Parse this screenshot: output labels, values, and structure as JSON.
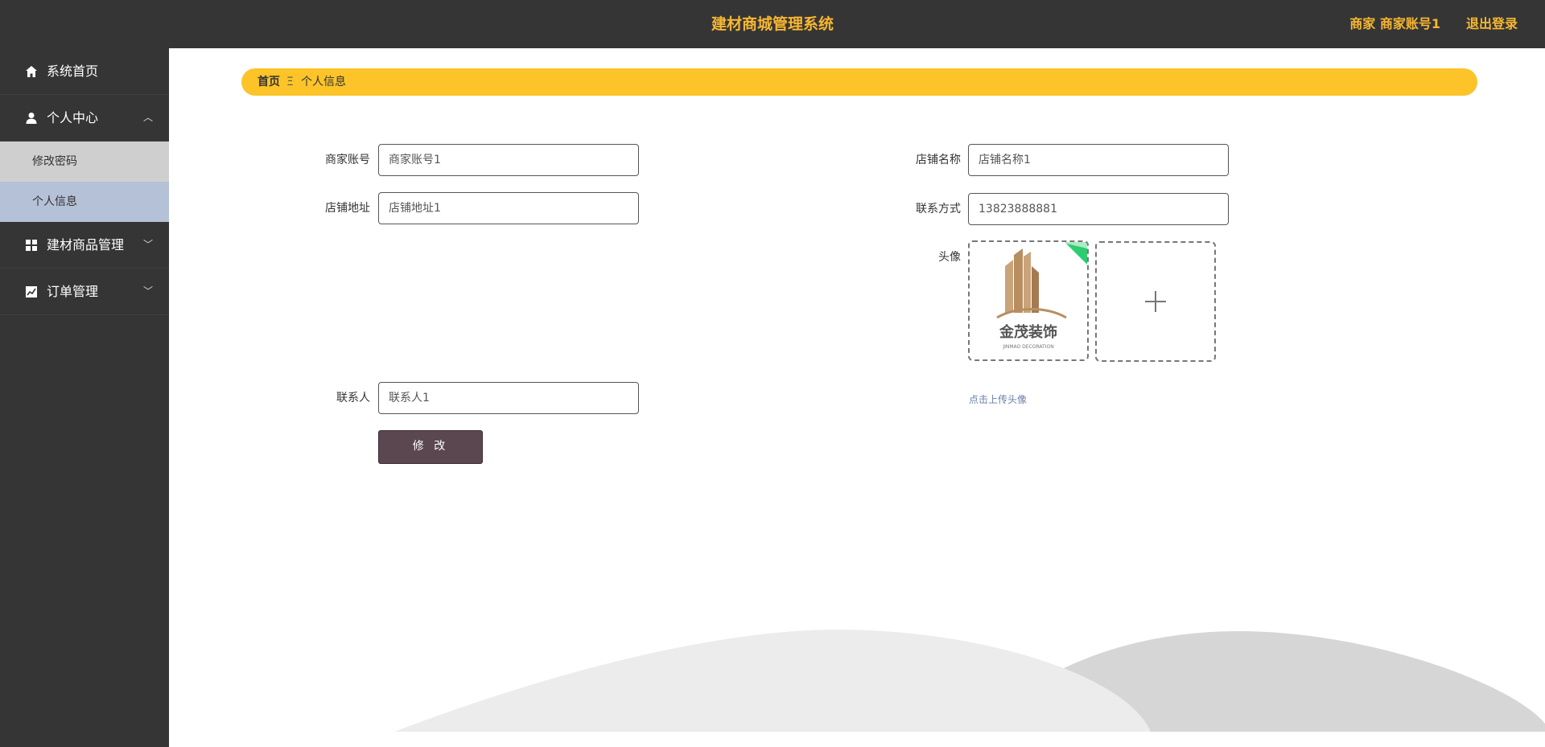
{
  "header": {
    "title": "建材商城管理系统",
    "user": "商家 商家账号1",
    "logout": "退出登录"
  },
  "sidebar": {
    "items": [
      {
        "label": "系统首页",
        "icon": "home-icon"
      },
      {
        "label": "个人中心",
        "icon": "user-icon"
      },
      {
        "label": "建材商品管理",
        "icon": "grid-icon"
      },
      {
        "label": "订单管理",
        "icon": "chart-icon"
      }
    ],
    "submenu": [
      "修改密码",
      "个人信息"
    ]
  },
  "breadcrumb": {
    "home": "首页",
    "separator": "Ξ",
    "current": "个人信息"
  },
  "form": {
    "account_label": "商家账号",
    "account_value": "商家账号1",
    "shop_name_label": "店铺名称",
    "shop_name_value": "店铺名称1",
    "address_label": "店铺地址",
    "address_value": "店铺地址1",
    "phone_label": "联系方式",
    "phone_value": "13823888881",
    "avatar_label": "头像",
    "contact_label": "联系人",
    "contact_value": "联系人1",
    "submit_label": "修 改",
    "upload_hint": "点击上传头像",
    "logo_text": "金茂装饰",
    "logo_subtext": "JINMAO DECORATION"
  },
  "colors": {
    "accent": "#f7b731",
    "breadcrumb_bg": "#fcc428",
    "sidebar_bg": "#353535",
    "submit_bg": "#5b474f",
    "active_sub_bg": "#b5c1d6",
    "success_corner": "#2ecc71"
  }
}
